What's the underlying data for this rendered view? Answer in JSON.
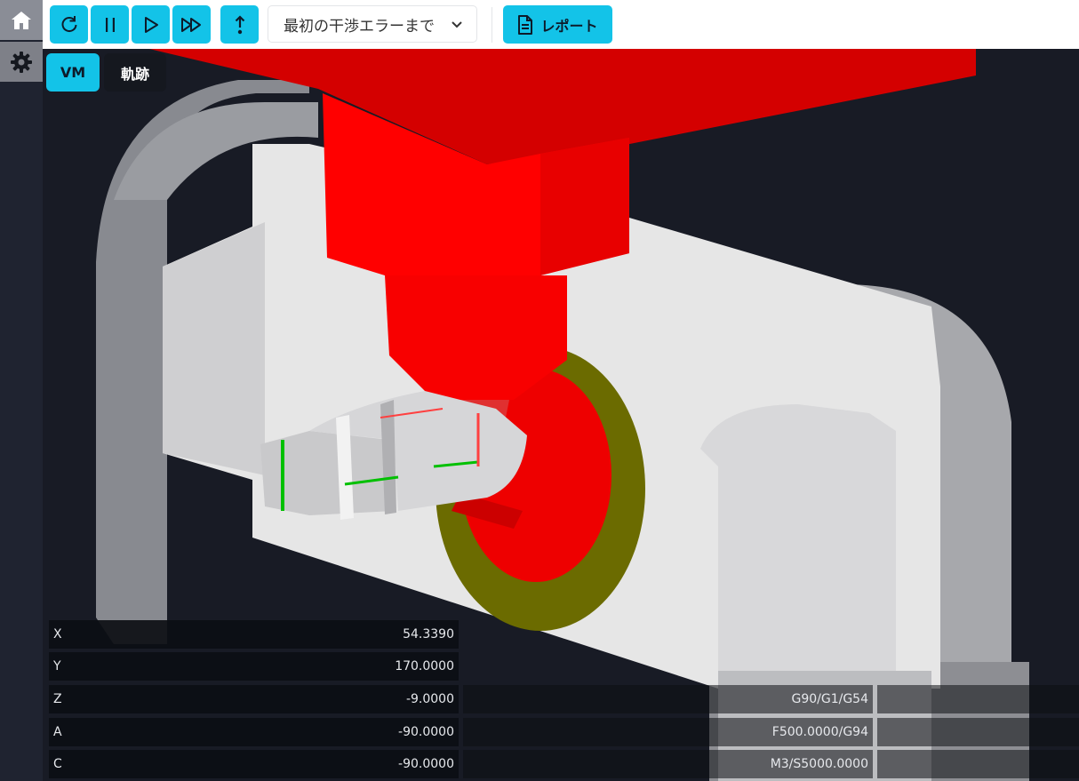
{
  "sidebar": {
    "items": [
      {
        "icon": "home-icon"
      },
      {
        "icon": "gear-icon"
      }
    ]
  },
  "toolbar": {
    "buttons": [
      {
        "icon": "reset-icon"
      },
      {
        "icon": "pause-icon"
      },
      {
        "icon": "play-icon"
      },
      {
        "icon": "fast-forward-icon"
      },
      {
        "icon": "step-up-icon"
      }
    ],
    "run_mode": {
      "selected": "最初の干渉エラーまで"
    },
    "report_label": "レポート"
  },
  "view_tabs": [
    {
      "label": "VM",
      "active": true
    },
    {
      "label": "軌跡",
      "active": false
    }
  ],
  "coordinates": [
    {
      "axis": "X",
      "value": "54.3390"
    },
    {
      "axis": "Y",
      "value": "170.0000"
    },
    {
      "axis": "Z",
      "value": "-9.0000"
    },
    {
      "axis": "A",
      "value": "-90.0000"
    },
    {
      "axis": "C",
      "value": "-90.0000"
    }
  ],
  "modal_states": [
    {
      "value": "G90/G1/G54"
    },
    {
      "value": "F500.0000/G94"
    },
    {
      "value": "M3/S5000.0000"
    }
  ],
  "colors": {
    "accent": "#13c3e8",
    "spindle": "#ff0000",
    "rotary_ring": "#6b6b00"
  }
}
